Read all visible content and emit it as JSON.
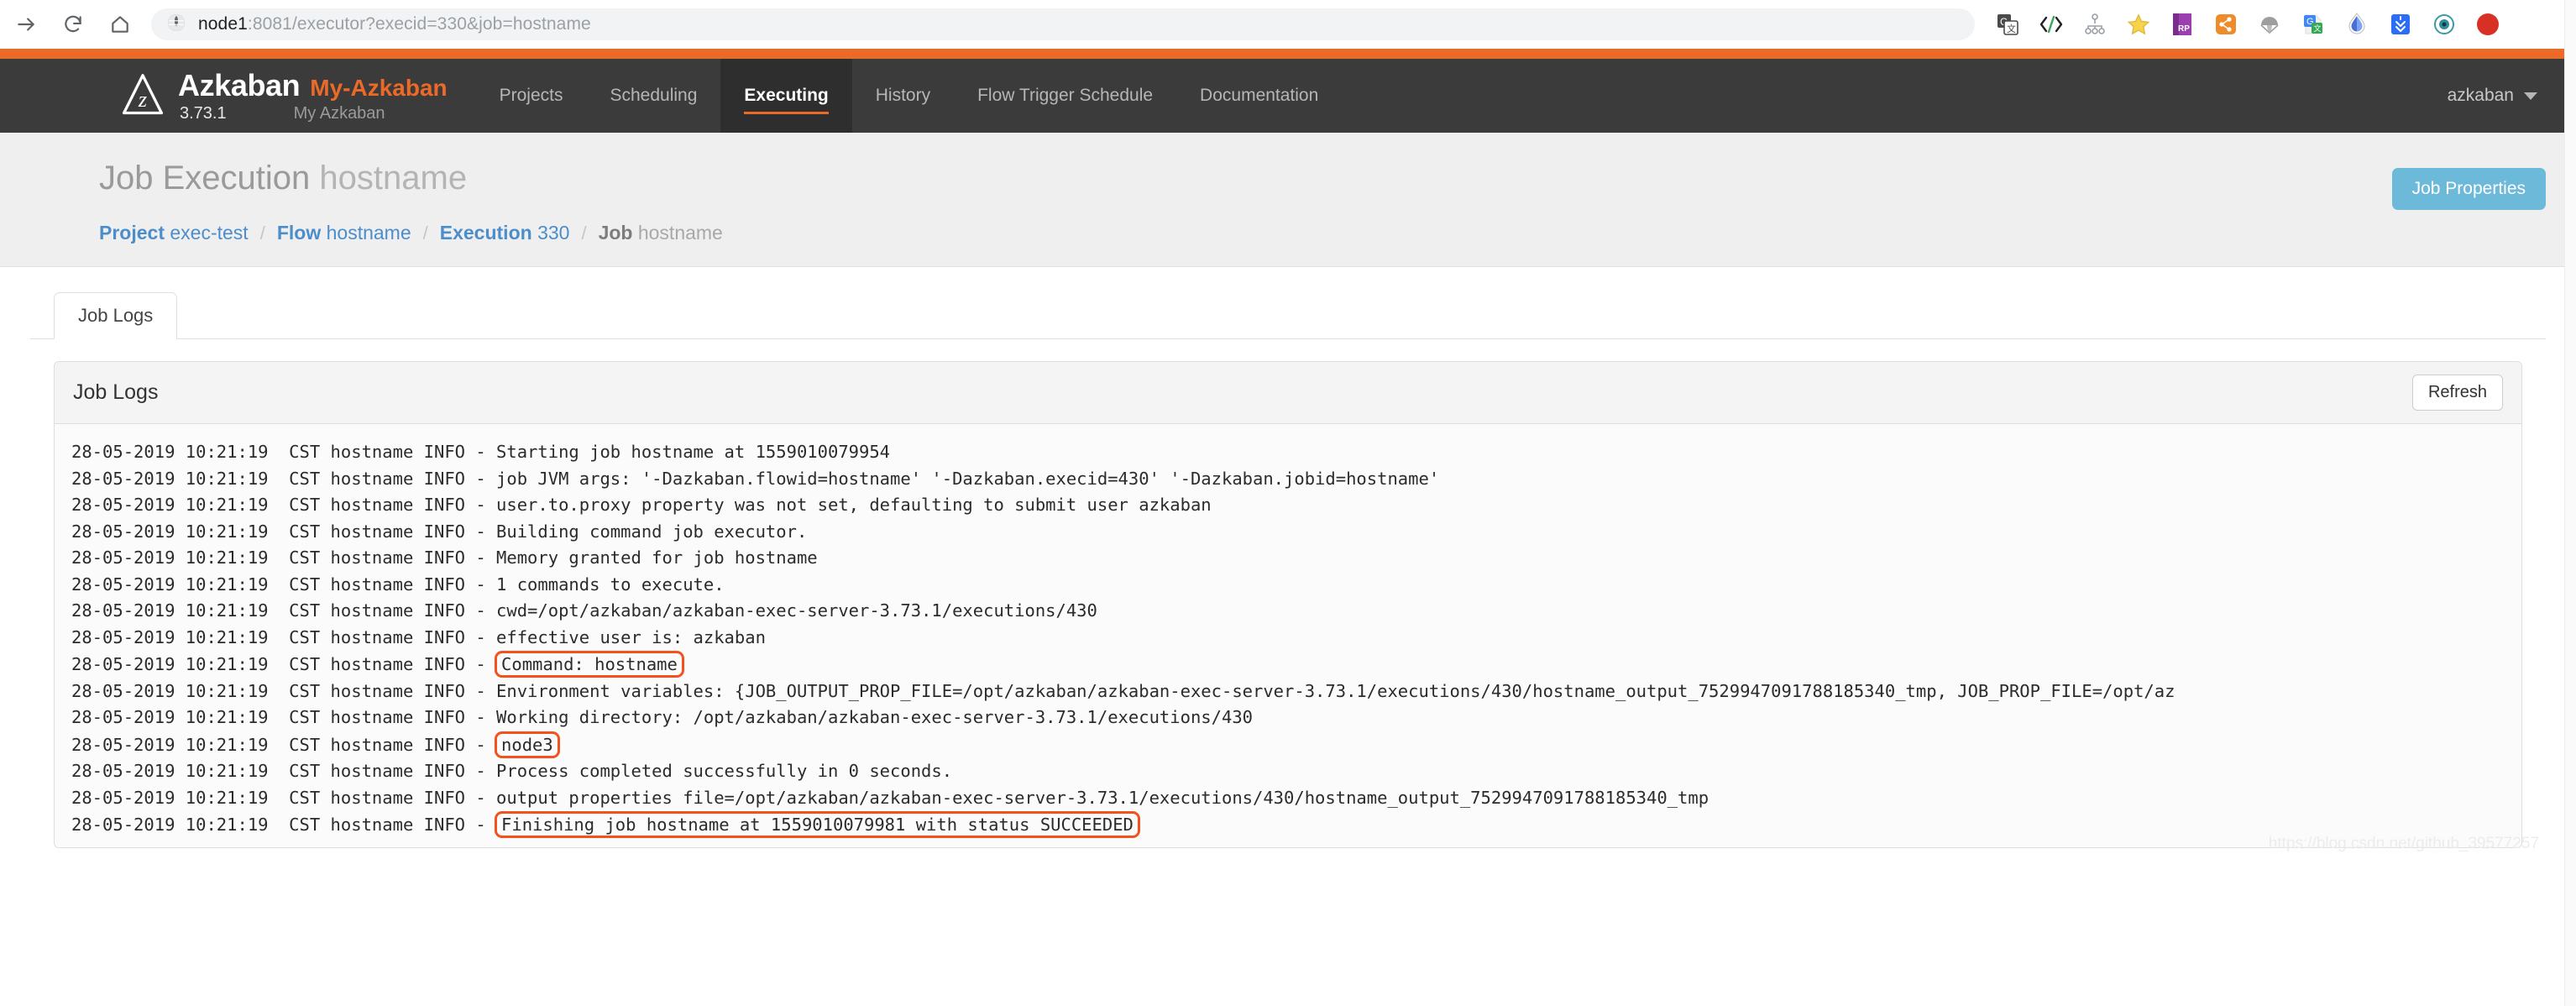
{
  "browser": {
    "nav_icons": [
      "forward-arrow-icon",
      "reload-icon",
      "home-icon"
    ],
    "url_host": "node1",
    "url_rest": ":8081/executor?execid=330&job=hostname",
    "site_icon": "globe-icon",
    "extensions": [
      {
        "name": "google-translate-extension-icon"
      },
      {
        "name": "code-brackets-extension-icon"
      },
      {
        "name": "sitemap-extension-icon"
      },
      {
        "name": "bookmark-star-icon"
      },
      {
        "name": "axure-rp-extension-icon"
      },
      {
        "name": "share-nodes-extension-icon"
      },
      {
        "name": "parachute-extension-icon"
      },
      {
        "name": "google-translate-doc-extension-icon"
      },
      {
        "name": "vpn-drop-extension-icon"
      },
      {
        "name": "downloads-extension-icon"
      },
      {
        "name": "eye-extension-icon"
      },
      {
        "name": "profile-avatar-icon"
      }
    ]
  },
  "header": {
    "logo_icon": "azkaban-logo-icon",
    "brand": "Azkaban",
    "brand_accent": "My-Azkaban",
    "version": "3.73.1",
    "subtitle": "My Azkaban",
    "menu": [
      {
        "label": "Projects",
        "active": false
      },
      {
        "label": "Scheduling",
        "active": false
      },
      {
        "label": "Executing",
        "active": true
      },
      {
        "label": "History",
        "active": false
      },
      {
        "label": "Flow Trigger Schedule",
        "active": false
      },
      {
        "label": "Documentation",
        "active": false
      }
    ],
    "user": "azkaban",
    "user_caret_icon": "chevron-down-icon"
  },
  "page": {
    "title_prefix": "Job Execution",
    "title_value": "hostname",
    "job_properties_button": "Job Properties",
    "breadcrumb": [
      {
        "label": "Project",
        "value": "exec-test",
        "current": false
      },
      {
        "label": "Flow",
        "value": "hostname",
        "current": false
      },
      {
        "label": "Execution",
        "value": "330",
        "current": false
      },
      {
        "label": "Job",
        "value": "hostname",
        "current": true
      }
    ],
    "separator": "/"
  },
  "main": {
    "tabs": [
      {
        "label": "Job Logs",
        "active": true
      }
    ],
    "panel_title": "Job Logs",
    "refresh_button": "Refresh",
    "watermark": "https://blog.csdn.net/github_39577257"
  },
  "log": {
    "prefix": "28-05-2019 10:21:19  CST hostname INFO - ",
    "lines": [
      {
        "text": "Starting job hostname at 1559010079954",
        "highlight": false
      },
      {
        "text": "job JVM args: '-Dazkaban.flowid=hostname' '-Dazkaban.execid=430' '-Dazkaban.jobid=hostname'",
        "highlight": false
      },
      {
        "text": "user.to.proxy property was not set, defaulting to submit user azkaban",
        "highlight": false
      },
      {
        "text": "Building command job executor.",
        "highlight": false
      },
      {
        "text": "Memory granted for job hostname",
        "highlight": false
      },
      {
        "text": "1 commands to execute.",
        "highlight": false
      },
      {
        "text": "cwd=/opt/azkaban/azkaban-exec-server-3.73.1/executions/430",
        "highlight": false
      },
      {
        "text": "effective user is: azkaban",
        "highlight": false
      },
      {
        "text": "Command: hostname",
        "highlight": true
      },
      {
        "text": "Environment variables: {JOB_OUTPUT_PROP_FILE=/opt/azkaban/azkaban-exec-server-3.73.1/executions/430/hostname_output_7529947091788185340_tmp, JOB_PROP_FILE=/opt/az",
        "highlight": false
      },
      {
        "text": "Working directory: /opt/azkaban/azkaban-exec-server-3.73.1/executions/430",
        "highlight": false
      },
      {
        "text": "node3",
        "highlight": true
      },
      {
        "text": "Process completed successfully in 0 seconds.",
        "highlight": false
      },
      {
        "text": "output properties file=/opt/azkaban/azkaban-exec-server-3.73.1/executions/430/hostname_output_7529947091788185340_tmp",
        "highlight": false
      },
      {
        "text": "Finishing job hostname at 1559010079981 with status SUCCEEDED",
        "highlight": true
      }
    ]
  },
  "colors": {
    "accent_orange": "#eb6a28",
    "nav_dark": "#3b3b3b",
    "link_blue": "#4b8ecb",
    "button_blue": "#6cb9da",
    "annotation_red": "#f4511e"
  }
}
